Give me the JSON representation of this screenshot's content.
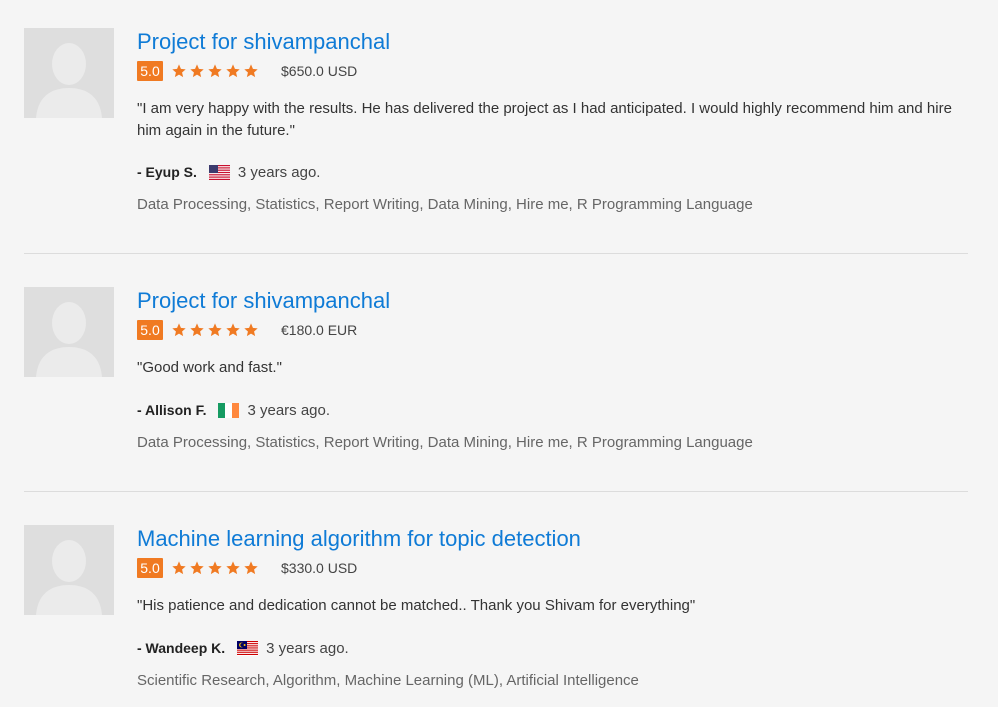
{
  "reviews": [
    {
      "title": "Project for shivampanchal",
      "rating": "5.0",
      "stars": 5,
      "amount": "$650.0 USD",
      "quote": "\"I am very happy with the results. He has delivered the project as I had anticipated. I would highly recommend him and hire him again in the future.\"",
      "author": "- Eyup S.",
      "flag_icon": "us-flag-icon",
      "when": "3 years ago.",
      "skills": "Data Processing, Statistics, Report Writing, Data Mining, Hire me, R Programming Language"
    },
    {
      "title": "Project for shivampanchal",
      "rating": "5.0",
      "stars": 5,
      "amount": "€180.0 EUR",
      "quote": "\"Good work and fast.\"",
      "author": "- Allison F.",
      "flag_icon": "ireland-flag-icon",
      "when": "3 years ago.",
      "skills": "Data Processing, Statistics, Report Writing, Data Mining, Hire me, R Programming Language"
    },
    {
      "title": "Machine learning algorithm for topic detection",
      "rating": "5.0",
      "stars": 5,
      "amount": "$330.0 USD",
      "quote": "\"His patience and dedication cannot be matched.. Thank you Shivam for everything\"",
      "author": "- Wandeep K.",
      "flag_icon": "malaysia-flag-icon",
      "when": "3 years ago.",
      "skills": "Scientific Research, Algorithm, Machine Learning (ML), Artificial Intelligence"
    }
  ],
  "colors": {
    "title": "#0f7bd6",
    "rating_badge": "#f07a22",
    "star": "#f07a22"
  }
}
